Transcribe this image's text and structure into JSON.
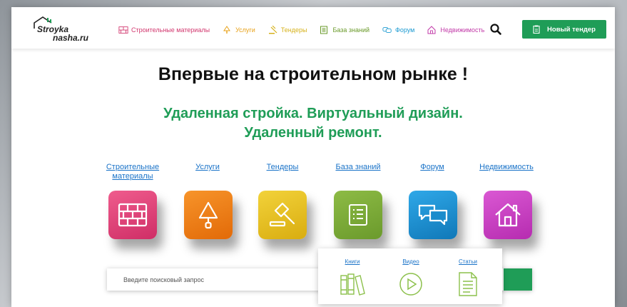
{
  "brand": {
    "logo_line1": "Stroyka",
    "logo_line2": "nasha.ru"
  },
  "nav": [
    {
      "label": "Строительные материалы",
      "icon": "brick-icon",
      "color": "#d2376e"
    },
    {
      "label": "Услуги",
      "icon": "trowel-icon",
      "color": "#e8a21a"
    },
    {
      "label": "Тендеры",
      "icon": "gavel-icon",
      "color": "#d6b21c"
    },
    {
      "label": "База знаний",
      "icon": "book-icon",
      "color": "#6a9a2a"
    },
    {
      "label": "Форум",
      "icon": "chat-icon",
      "color": "#1b9ad1"
    },
    {
      "label": "Недвижимость",
      "icon": "house-icon",
      "color": "#c23aa8"
    }
  ],
  "header": {
    "search_icon": "search-icon",
    "tender_button": "Новый тендер"
  },
  "hero": {
    "title": "Впервые на строительном рынке !",
    "subtitle_line1": "Удаленная стройка. Виртуальный дизайн.",
    "subtitle_line2": "Удаленный ремонт."
  },
  "categories": [
    {
      "label_line1": "Строительные",
      "label_line2": "материалы",
      "icon": "brick-icon",
      "color": "#e2407a"
    },
    {
      "label_line1": "Услуги",
      "label_line2": "",
      "icon": "trowel-icon",
      "color": "#f07c12"
    },
    {
      "label_line1": "Тендеры",
      "label_line2": "",
      "icon": "gavel-icon",
      "color": "#e6c21a"
    },
    {
      "label_line1": "База знаний",
      "label_line2": "",
      "icon": "checklist-icon",
      "color": "#7aa33a"
    },
    {
      "label_line1": "Форум",
      "label_line2": "",
      "icon": "chat-icon",
      "color": "#1f8fd0"
    },
    {
      "label_line1": "Недвижимость",
      "label_line2": "",
      "icon": "house-icon",
      "color": "#c83fc0"
    }
  ],
  "search": {
    "placeholder": "Введите поисковый запрос"
  },
  "knowledge_dropdown": [
    {
      "label": "Книги",
      "icon": "books-icon"
    },
    {
      "label": "Видео",
      "icon": "play-icon"
    },
    {
      "label": "Статьи",
      "icon": "document-icon"
    }
  ],
  "colors": {
    "accent_green": "#1f9d57",
    "link_blue": "#1a73c8"
  }
}
